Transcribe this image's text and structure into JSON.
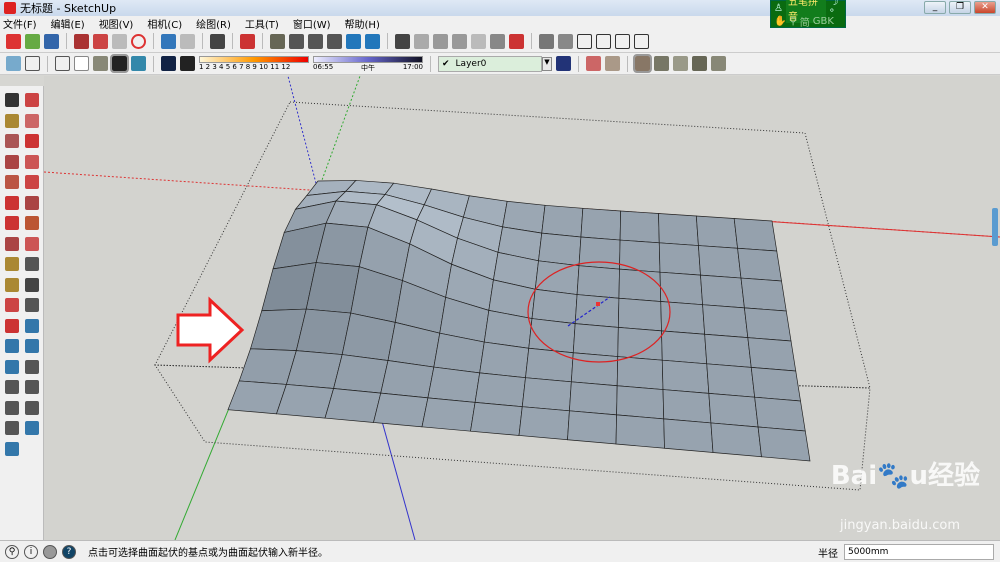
{
  "window": {
    "title": "无标题 - SketchUp"
  },
  "ime": {
    "name": "五笔拼音",
    "mode": "简",
    "charset": "GBK"
  },
  "menu": [
    "文件(F)",
    "编辑(E)",
    "视图(V)",
    "相机(C)",
    "绘图(R)",
    "工具(T)",
    "窗口(W)",
    "帮助(H)"
  ],
  "shadows": {
    "months": "1 2 3 4 5 6 7 8 9 10 11 12",
    "time_start": "06:55",
    "time_mid": "中午",
    "time_end": "17:00"
  },
  "layer": {
    "current": "Layer0"
  },
  "status": {
    "message": "点击可选择曲面起伏的基点或为曲面起伏输入新半径。",
    "vcb_label": "半径",
    "vcb_value": "5000mm"
  },
  "watermark": {
    "text": "Baidu经验",
    "url": "jingyan.baidu.com"
  },
  "colors": {
    "red_axis": "#d33",
    "green_axis": "#3a3",
    "blue_axis": "#33c",
    "mesh": "#b9c6d3"
  }
}
